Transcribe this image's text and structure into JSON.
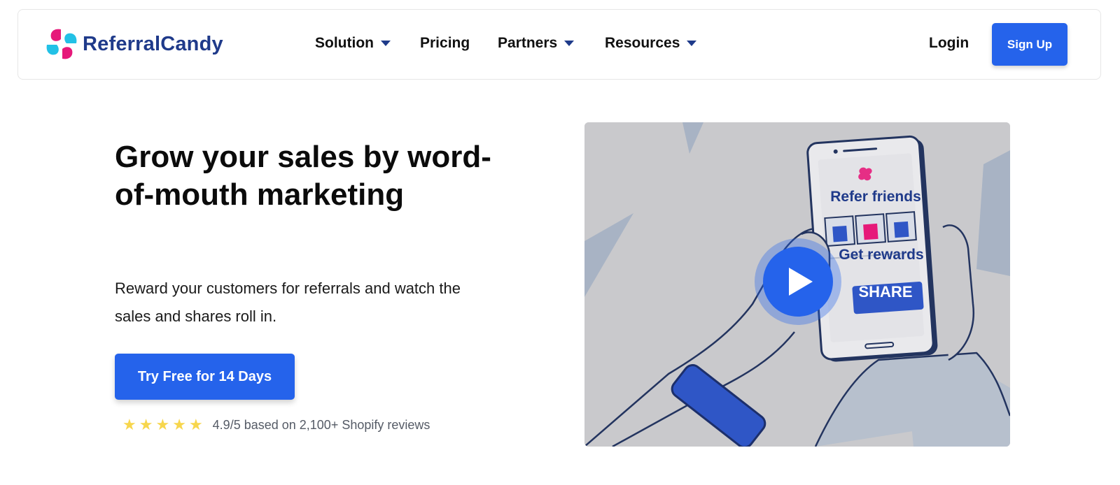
{
  "brand": {
    "name": "ReferralCandy",
    "colors": {
      "primary": "#2563eb",
      "navy": "#1f3a8a",
      "pink": "#e6197a",
      "cyan": "#22c1e6",
      "star": "#f7d64d"
    }
  },
  "nav": {
    "items": [
      {
        "label": "Solution",
        "has_dropdown": true
      },
      {
        "label": "Pricing",
        "has_dropdown": false
      },
      {
        "label": "Partners",
        "has_dropdown": true
      },
      {
        "label": "Resources",
        "has_dropdown": true
      }
    ],
    "login_label": "Login",
    "signup_label": "Sign Up"
  },
  "hero": {
    "title": "Grow your sales by word-of-mouth marketing",
    "subtitle": "Reward your customers for referrals and watch the sales and shares roll in.",
    "cta_label": "Try Free for 14 Days",
    "rating": {
      "stars": 5,
      "text": "4.9/5 based on 2,100+ Shopify reviews"
    }
  },
  "video": {
    "phone_title": "Refer friends",
    "phone_subtitle": "Get rewards",
    "share_label": "SHARE",
    "play_icon": "play-icon"
  }
}
